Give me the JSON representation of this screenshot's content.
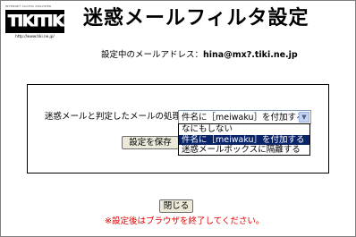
{
  "logo": {
    "tagline": "INTERNET ACCESS PROVIDER",
    "wordmark": "TIKITIKI",
    "url": "http://www.tiki.ne.jp/"
  },
  "page": {
    "title": "迷惑メールフィルタ設定"
  },
  "address": {
    "label": "設定中のメールアドレス：",
    "value": "hina@mx?.tiki.ne.jp"
  },
  "form": {
    "processing_label": "迷惑メールと判定したメールの処理",
    "selected_value": "件名に［meiwaku］を付加する",
    "options": [
      "なにもしない",
      "件名に［meiwaku］を付加する",
      "迷惑メールボックスに隔離する"
    ],
    "highlighted_index": 1,
    "save_label": "設定を保存"
  },
  "footer": {
    "close_label": "閉じる",
    "note": "※設定後はブラウザを終了してください。",
    "note_color": "#e00000"
  }
}
